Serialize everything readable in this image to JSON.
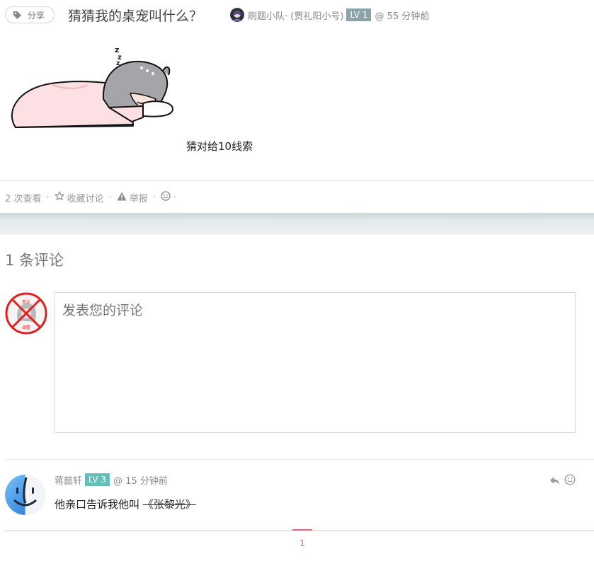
{
  "topic": {
    "category": "分享",
    "category_icon": "tag-icon",
    "title": "猜猜我的桌宠叫什么？",
    "author": "刷题小队· (贾礼阳小号)",
    "author_level": "LV 1",
    "posted_time": "@ 55 分钟前",
    "content_image": "sleeping-girl-sticker",
    "content_text": "猜对给10线索"
  },
  "meta": {
    "views": "2 次查看",
    "favorite_label": "收藏讨论",
    "favorite_icon": "star-outline-icon",
    "report_label": "举报",
    "report_icon": "warning-triangle-icon",
    "emoji_icon": "smiley-icon"
  },
  "comments_section": {
    "heading": "1 条评论",
    "placeholder": "发表您的评论",
    "my_avatar_label_top": "禁止",
    "my_avatar_label_bottom": "调整"
  },
  "comments": [
    {
      "author": "蒋懿轩",
      "level": "LV 3",
      "time": "@ 15 分钟前",
      "text": "他亲口告诉我他叫 ",
      "struck_text": "《张黎光》",
      "reply_icon": "reply-icon",
      "emoji_icon": "smiley-icon"
    }
  ],
  "pagination": {
    "current_page": "1"
  },
  "colors": {
    "accent": "#e46b7f",
    "level1": "#8aa3ab",
    "level3": "#62c0b8",
    "band": "#dfe5e8"
  }
}
